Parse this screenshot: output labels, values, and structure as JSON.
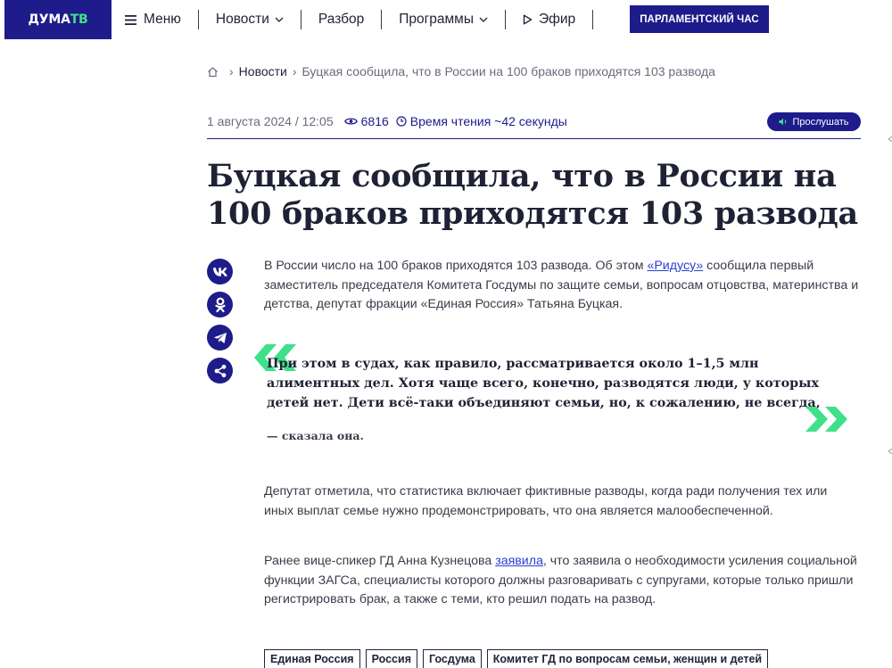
{
  "header": {
    "logo_part1": "ДУМА",
    "logo_part2": "ТВ",
    "nav": [
      {
        "label": "Меню"
      },
      {
        "label": "Новости"
      },
      {
        "label": "Разбор"
      },
      {
        "label": "Программы"
      },
      {
        "label": "Эфир"
      }
    ],
    "cta_label": "ПАРЛАМЕНТСКИЙ ЧАС",
    "brand_color": "#1e1b8a",
    "accent_color": "#3ee08a"
  },
  "breadcrumb": {
    "section": "Новости",
    "current": "Буцкая сообщила, что в России на 100 браков приходятся 103 развода"
  },
  "meta": {
    "date": "1 августа 2024 / 12:05",
    "views": "6816",
    "read_time": "Время чтения ~42 секунды",
    "listen_label": "Прослушать"
  },
  "article": {
    "title": "Буцкая сообщила, что в России на 100 браков приходятся 103 развода",
    "p1_before": "В России число на 100 браков приходятся 103 развода. Об этом ",
    "p1_link": "«Ридусу»",
    "p1_after": " сообщила первый заместитель председателя Комитета Госдумы по защите семьи, вопросам отцовства, материнства и детства, депутат фракции «Единая Россия» Татьяна Буцкая.",
    "quote": "При этом в судах, как правило, рассматривается около 1–1,5 млн алиментных дел. Хотя чаще всего, конечно, разводятся люди, у которых детей нет. Дети всё-таки объединяют семьи, но, к сожалению, не всегда,",
    "quote_source": "— сказала она.",
    "p2": "Депутат отметила, что  статистика включает фиктивные разводы, когда ради получения тех или иных выплат семье нужно продемонстрировать, что она является малообеспеченной.",
    "p3_before": "Ранее вице-спикер ГД Анна Кузнецова ",
    "p3_link": "заявила",
    "p3_after": ", что заявила о необходимости усиления социальной функции ЗАГСа, специалисты которого должны разговаривать с супругами, которые только пришли регистрировать брак, а также с теми, кто решил подать на развод."
  },
  "share": [
    "vk-icon",
    "odnoklassniki-icon",
    "telegram-icon",
    "share-icon"
  ],
  "tags": [
    {
      "label": "Единая Россия"
    },
    {
      "label": "Россия"
    },
    {
      "label": "Госдума"
    },
    {
      "label": "Комитет ГД по вопросам семьи, женщин и детей"
    }
  ]
}
